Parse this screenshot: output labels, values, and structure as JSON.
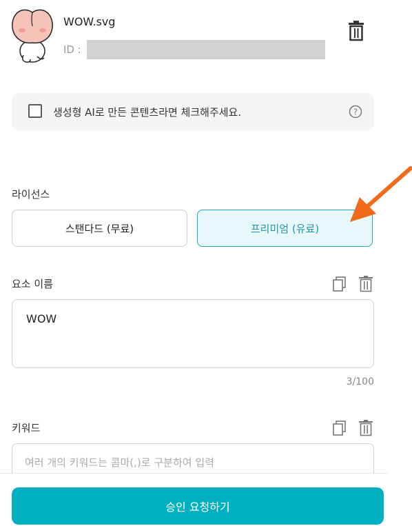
{
  "file": {
    "name": "WOW.svg",
    "id_label": "ID :"
  },
  "ai_check": {
    "label": "생성형 AI로 만든 콘텐츠라면 체크해주세요."
  },
  "license": {
    "label": "라이선스",
    "options": [
      "스탠다드 (무료)",
      "프리미엄 (유료)"
    ],
    "selected": "프리미엄 (유료)"
  },
  "element_name": {
    "label": "요소 이름",
    "value": "WOW",
    "counter": "3/100"
  },
  "keywords": {
    "label": "키워드",
    "placeholder": "여러 개의 키워드는 콤마(,)로 구분하여 입력"
  },
  "submit": {
    "label": "승인 요청하기"
  },
  "colors": {
    "accent": "#00b0c0",
    "selected_bg": "#e8f7f9",
    "arrow": "#f26a1b"
  }
}
